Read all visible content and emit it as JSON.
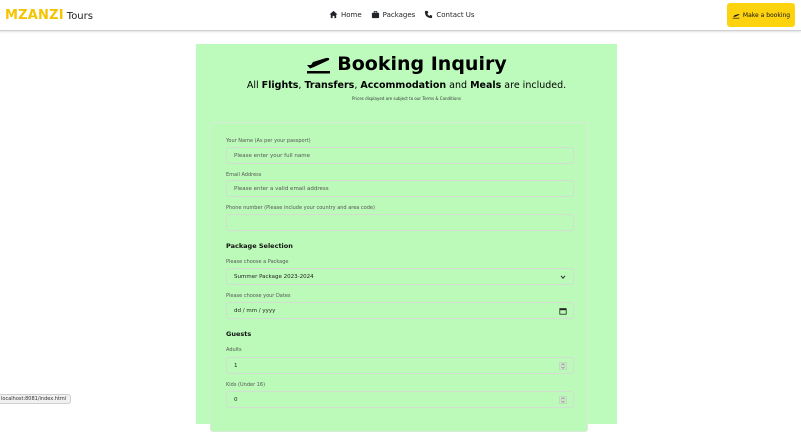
{
  "brand": {
    "main": "MZANZI",
    "sub": "Tours"
  },
  "nav": {
    "home": "Home",
    "packages": "Packages",
    "contact": "Contact Us",
    "cta": "Make a booking"
  },
  "booking": {
    "title": "Booking Inquiry",
    "subtitle_prefix": "All ",
    "flights": "Flights",
    "sep1": ", ",
    "transfers": "Transfers",
    "sep2": ", ",
    "accommodation": "Accommodation",
    "and": " and ",
    "meals": "Meals",
    "suffix": " are included.",
    "fine_print": "Prices displayed are subject to our Terms & Conditions"
  },
  "form": {
    "name_label": "Your Name (As per your passport)",
    "name_placeholder": "Please enter your full name",
    "email_label": "Email Address",
    "email_placeholder": "Please enter a valid email address",
    "phone_label": "Phone number (Please include your country and area code)",
    "phone_value": "",
    "package_section": "Package Selection",
    "package_label": "Please choose a Package",
    "package_value": "Summer Package 2023-2024",
    "dates_label": "Please choose your Dates",
    "dates_value": "dd / mm / yyyy",
    "guests_section": "Guests",
    "adults_label": "Adults",
    "adults_value": "1",
    "kids_label": "Kids (Under 16)",
    "kids_value": "0"
  },
  "status_bar": {
    "url": "localhost:8081/index.html"
  },
  "colors": {
    "accent": "#fdd20f",
    "panel": "#bdfbbd",
    "brand": "#f5c400"
  },
  "icons": [
    "home-icon",
    "suitcase-icon",
    "phone-icon",
    "plane-departure-icon",
    "calendar-icon",
    "chevron-down-icon",
    "spinner-arrows-icon"
  ]
}
